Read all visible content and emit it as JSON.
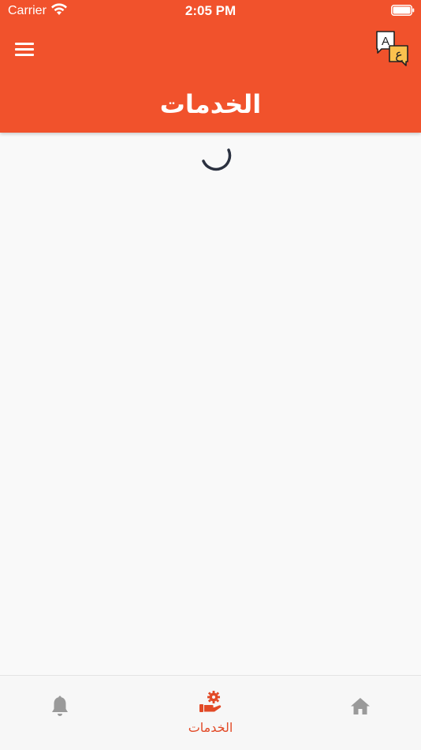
{
  "status_bar": {
    "carrier": "Carrier",
    "time": "2:05 PM"
  },
  "header": {
    "title": "الخدمات",
    "background_color": "#f1522c",
    "menu_icon": "hamburger-menu-icon",
    "language_icon": "translate-language-icon",
    "language_letters": {
      "latin": "A",
      "arabic": "ع"
    }
  },
  "content": {
    "loading": true,
    "spinner_color": "#2b3140"
  },
  "tabbar": {
    "active_color": "#e24a27",
    "inactive_color": "#9a9a9a",
    "tabs": [
      {
        "icon": "bell-icon",
        "label": "",
        "active": false
      },
      {
        "icon": "hand-gear-services-icon",
        "label": "الخدمات",
        "active": true
      },
      {
        "icon": "home-icon",
        "label": "",
        "active": false
      }
    ]
  }
}
